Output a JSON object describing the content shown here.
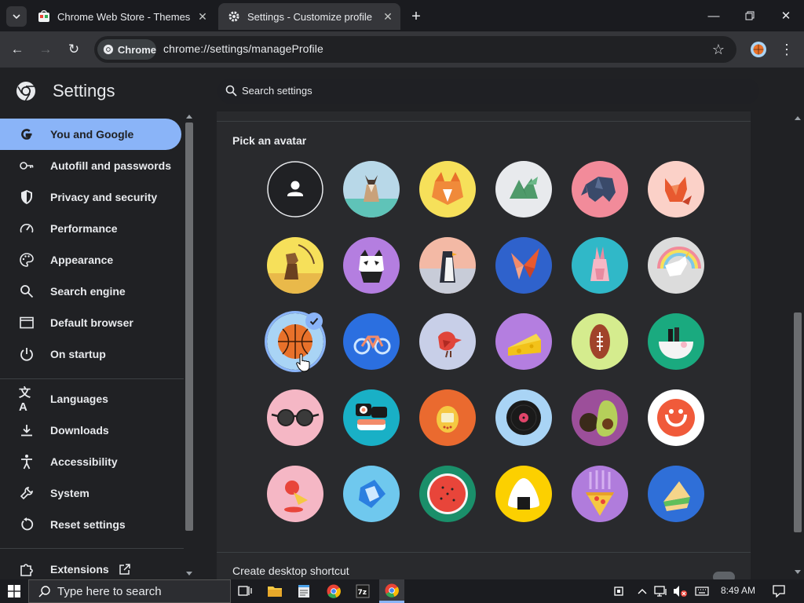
{
  "browser": {
    "tabs": [
      {
        "title": "Chrome Web Store - Themes",
        "active": false
      },
      {
        "title": "Settings - Customize profile",
        "active": true
      }
    ],
    "chip_label": "Chrome",
    "url": "chrome://settings/manageProfile"
  },
  "settings": {
    "title": "Settings",
    "search_placeholder": "Search settings",
    "nav": [
      {
        "label": "You and Google",
        "icon": "google-g-icon",
        "active": true
      },
      {
        "label": "Autofill and passwords",
        "icon": "key-icon"
      },
      {
        "label": "Privacy and security",
        "icon": "shield-icon"
      },
      {
        "label": "Performance",
        "icon": "speedometer-icon"
      },
      {
        "label": "Appearance",
        "icon": "palette-icon"
      },
      {
        "label": "Search engine",
        "icon": "search-icon"
      },
      {
        "label": "Default browser",
        "icon": "browser-window-icon"
      },
      {
        "label": "On startup",
        "icon": "power-icon"
      },
      {
        "label": "Languages",
        "icon": "translate-icon"
      },
      {
        "label": "Downloads",
        "icon": "download-icon"
      },
      {
        "label": "Accessibility",
        "icon": "accessibility-icon"
      },
      {
        "label": "System",
        "icon": "wrench-icon"
      },
      {
        "label": "Reset settings",
        "icon": "reset-icon"
      },
      {
        "label": "Extensions",
        "icon": "puzzle-icon"
      }
    ],
    "section_title": "Pick an avatar",
    "shortcut_label": "Create desktop shortcut",
    "avatars": [
      {
        "name": "silhouette",
        "bg": "#202124"
      },
      {
        "name": "origami-cat",
        "bg": "#b8d8e8"
      },
      {
        "name": "origami-corgi",
        "bg": "#f6e05a"
      },
      {
        "name": "origami-dragon",
        "bg": "#e8eaed"
      },
      {
        "name": "origami-elephant",
        "bg": "#f28b9a"
      },
      {
        "name": "origami-fox",
        "bg": "#fbd1c8"
      },
      {
        "name": "origami-monkey",
        "bg": "#f6e05a"
      },
      {
        "name": "origami-panda",
        "bg": "#b47ee0"
      },
      {
        "name": "origami-penguin",
        "bg": "#f3b9a5"
      },
      {
        "name": "origami-butterfly",
        "bg": "#2f62cc"
      },
      {
        "name": "origami-rabbit",
        "bg": "#30b8c8"
      },
      {
        "name": "origami-unicorn",
        "bg": "#dcdcdc"
      },
      {
        "name": "basketball",
        "bg": "#a9d4f5",
        "selected": true
      },
      {
        "name": "bike",
        "bg": "#2b6fe0"
      },
      {
        "name": "bird",
        "bg": "#c8cfe8"
      },
      {
        "name": "cheese",
        "bg": "#b47ee0"
      },
      {
        "name": "football",
        "bg": "#d5ec8e"
      },
      {
        "name": "ramen",
        "bg": "#1aaa7f"
      },
      {
        "name": "sunglasses",
        "bg": "#f5b7c5"
      },
      {
        "name": "sushi",
        "bg": "#19b0c6"
      },
      {
        "name": "tamagotchi",
        "bg": "#ea6a2f"
      },
      {
        "name": "vinyl",
        "bg": "#a9d4f5"
      },
      {
        "name": "avocado",
        "bg": "#9c4f9a"
      },
      {
        "name": "smiley",
        "bg": "#ffffff"
      },
      {
        "name": "ice-cream",
        "bg": "#f5b7c5"
      },
      {
        "name": "napkin",
        "bg": "#6fc8ee"
      },
      {
        "name": "watermelon",
        "bg": "#1a8f6a"
      },
      {
        "name": "onigiri",
        "bg": "#fcd000"
      },
      {
        "name": "pizza",
        "bg": "#b07cdc"
      },
      {
        "name": "sandwich",
        "bg": "#2f6fd8"
      }
    ]
  },
  "taskbar": {
    "search_placeholder": "Type here to search",
    "time": "8:49 AM"
  },
  "colors": {
    "accent": "#8ab4f8",
    "background": "#202124",
    "card": "#292a2d"
  }
}
